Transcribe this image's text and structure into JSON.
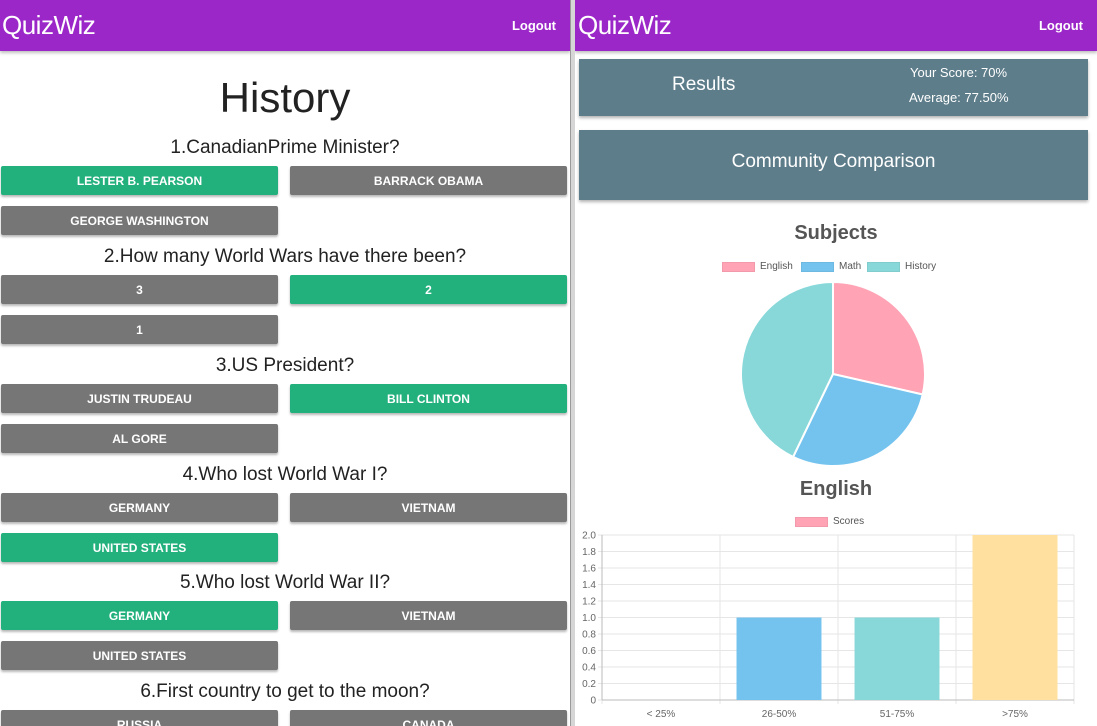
{
  "left": {
    "brand": "QuizWiz",
    "logout": "Logout",
    "page_title": "History",
    "questions": [
      {
        "text": "1.CanadianPrime Minister?",
        "answers": [
          {
            "label": "Lester B. Pearson",
            "correct": true
          },
          {
            "label": "Barrack Obama",
            "correct": false
          },
          {
            "label": "George Washington",
            "correct": false
          }
        ]
      },
      {
        "text": "2.How many World Wars have there been?",
        "answers": [
          {
            "label": "3",
            "correct": false
          },
          {
            "label": "2",
            "correct": true
          },
          {
            "label": "1",
            "correct": false
          }
        ]
      },
      {
        "text": "3.US President?",
        "answers": [
          {
            "label": "Justin Trudeau",
            "correct": false
          },
          {
            "label": "Bill Clinton",
            "correct": true
          },
          {
            "label": "Al Gore",
            "correct": false
          }
        ]
      },
      {
        "text": "4.Who lost World War I?",
        "answers": [
          {
            "label": "Germany",
            "correct": false
          },
          {
            "label": "Vietnam",
            "correct": false
          },
          {
            "label": "United States",
            "correct": true
          }
        ]
      },
      {
        "text": "5.Who lost World War II?",
        "answers": [
          {
            "label": "Germany",
            "correct": true
          },
          {
            "label": "Vietnam",
            "correct": false
          },
          {
            "label": "United States",
            "correct": false
          }
        ]
      },
      {
        "text": "6.First country to get to the moon?",
        "answers": [
          {
            "label": "Russia",
            "correct": false
          },
          {
            "label": "Canada",
            "correct": false
          }
        ]
      }
    ]
  },
  "right": {
    "brand": "QuizWiz",
    "logout": "Logout",
    "results_label": "Results",
    "your_score": "Your Score: 70%",
    "average": "Average: 77.50%",
    "community_label": "Community Comparison"
  },
  "colors": {
    "brand_purple": "#9b27c8",
    "correct_green": "#22b07d",
    "answer_gray": "#767676",
    "panel_slate": "#5e7d8a"
  },
  "chart_data": [
    {
      "type": "pie",
      "title": "Subjects",
      "legend_position": "top",
      "labels": [
        "English",
        "Math",
        "History"
      ],
      "values": [
        1,
        1,
        1.5
      ],
      "colors": [
        "#ffa3b5",
        "#74c3ef",
        "#88d8da"
      ]
    },
    {
      "type": "bar",
      "title": "English",
      "legend_position": "top",
      "categories": [
        "< 25%",
        "26-50%",
        "51-75%",
        ">75%"
      ],
      "series": [
        {
          "name": "Scores",
          "values": [
            0,
            1,
            1,
            2
          ]
        }
      ],
      "legend_color": "#ffa3b5",
      "colors": [
        "#ffa3b5",
        "#74c3ef",
        "#88d8da",
        "#ffe09e"
      ],
      "ylim": [
        0,
        2
      ],
      "yticks": [
        "0",
        "0.2",
        "0.4",
        "0.6",
        "0.8",
        "1.0",
        "1.2",
        "1.4",
        "1.6",
        "1.8",
        "2.0"
      ],
      "grid": true
    }
  ]
}
